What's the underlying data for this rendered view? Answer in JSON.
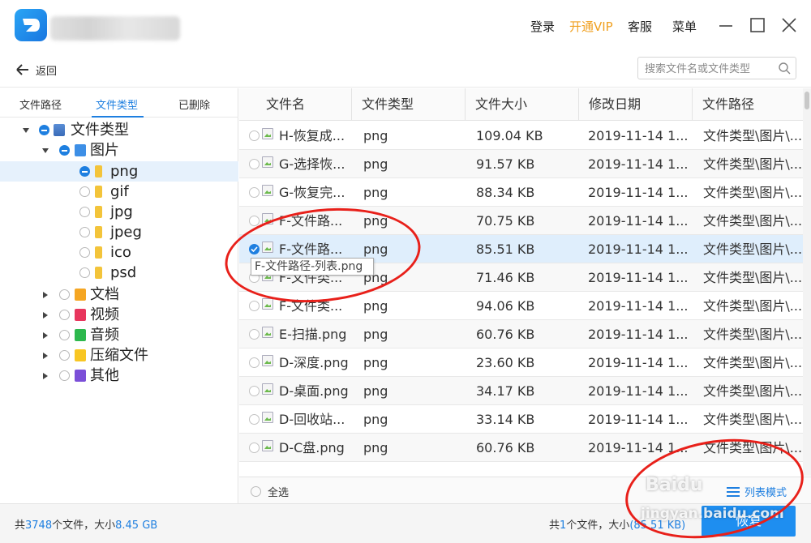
{
  "titlebar": {
    "login": "登录",
    "vip": "开通VIP",
    "service": "客服",
    "menu": "菜单"
  },
  "toolbar": {
    "back_label": "返回",
    "search_placeholder": "搜索文件名或文件类型"
  },
  "sidebar": {
    "tabs": [
      "文件路径",
      "文件类型",
      "已删除"
    ],
    "active_tab": "文件类型",
    "tree": {
      "root": "文件类型",
      "pictures": "图片",
      "png": "png",
      "gif": "gif",
      "jpg": "jpg",
      "jpeg": "jpeg",
      "ico": "ico",
      "psd": "psd",
      "docs": "文档",
      "video": "视频",
      "audio": "音频",
      "archive": "压缩文件",
      "other": "其他"
    }
  },
  "table": {
    "headers": [
      "文件名",
      "文件类型",
      "文件大小",
      "修改日期",
      "文件路径"
    ],
    "rows": [
      {
        "name": "H-恢复成...",
        "type": "png",
        "size": "109.04 KB",
        "date": "2019-11-14 1...",
        "path": "文件类型\\图片\\..."
      },
      {
        "name": "G-选择恢...",
        "type": "png",
        "size": "91.57 KB",
        "date": "2019-11-14 1...",
        "path": "文件类型\\图片\\..."
      },
      {
        "name": "G-恢复完...",
        "type": "png",
        "size": "88.34 KB",
        "date": "2019-11-14 1...",
        "path": "文件类型\\图片\\..."
      },
      {
        "name": "F-文件路...",
        "type": "png",
        "size": "70.75 KB",
        "date": "2019-11-14 1...",
        "path": "文件类型\\图片\\..."
      },
      {
        "name": "F-文件路...",
        "type": "png",
        "size": "85.51 KB",
        "date": "2019-11-14 1...",
        "path": "文件类型\\图片\\..."
      },
      {
        "name": "F-文件类...",
        "type": "png",
        "size": "71.46 KB",
        "date": "2019-11-14 1...",
        "path": "文件类型\\图片\\..."
      },
      {
        "name": "F-文件类...",
        "type": "png",
        "size": "94.06 KB",
        "date": "2019-11-14 1...",
        "path": "文件类型\\图片\\..."
      },
      {
        "name": "E-扫描.png",
        "type": "png",
        "size": "60.76 KB",
        "date": "2019-11-14 1...",
        "path": "文件类型\\图片\\..."
      },
      {
        "name": "D-深度.png",
        "type": "png",
        "size": "23.60 KB",
        "date": "2019-11-14 1...",
        "path": "文件类型\\图片\\..."
      },
      {
        "name": "D-桌面.png",
        "type": "png",
        "size": "34.17 KB",
        "date": "2019-11-14 1...",
        "path": "文件类型\\图片\\..."
      },
      {
        "name": "D-回收站...",
        "type": "png",
        "size": "33.14 KB",
        "date": "2019-11-14 1...",
        "path": "文件类型\\图片\\..."
      },
      {
        "name": "D-C盘.png",
        "type": "png",
        "size": "60.76 KB",
        "date": "2019-11-14 1...",
        "path": "文件类型\\图片\\..."
      }
    ],
    "tooltip": "F-文件路径-列表.png"
  },
  "footer": {
    "select_all": "全选",
    "mode_label": "列表模式",
    "total_prefix": "共",
    "total_count": "3748",
    "total_mid": "个文件，大小",
    "total_size": "8.45 GB",
    "sel_prefix": "共",
    "sel_count": "1",
    "sel_mid": "个文件，大小",
    "sel_size": "(85.51 KB)",
    "recover_label": "恢复"
  },
  "watermark": {
    "brand": "Baidu",
    "site": "jingyan.baidu.com"
  },
  "colors": {
    "accent": "#1e7fe0",
    "vip": "#f0a020",
    "annotation": "#e8201a",
    "selected_row": "#dfeefc"
  }
}
